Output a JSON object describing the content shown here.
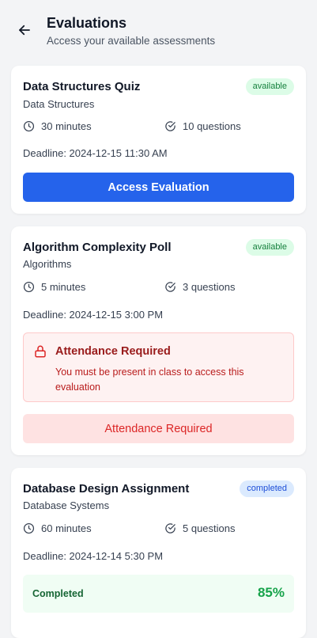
{
  "header": {
    "title": "Evaluations",
    "subtitle": "Access your available assessments"
  },
  "evaluations": [
    {
      "title": "Data Structures Quiz",
      "course": "Data Structures",
      "status": "available",
      "duration": "30 minutes",
      "questions": "10 questions",
      "deadline": "Deadline: 2024-12-15 11:30 AM",
      "action_label": "Access Evaluation"
    },
    {
      "title": "Algorithm Complexity Poll",
      "course": "Algorithms",
      "status": "available",
      "duration": "5 minutes",
      "questions": "3 questions",
      "deadline": "Deadline: 2024-12-15 3:00 PM",
      "alert": {
        "title": "Attendance Required",
        "text": "You must be present in class to access this evaluation"
      },
      "action_label": "Attendance Required"
    },
    {
      "title": "Database Design Assignment",
      "course": "Database Systems",
      "status": "completed",
      "duration": "60 minutes",
      "questions": "5 questions",
      "deadline": "Deadline: 2024-12-14 5:30 PM",
      "result": {
        "label": "Completed",
        "score": "85%"
      }
    }
  ],
  "colors": {
    "primary": "#2563eb",
    "danger": "#dc2626",
    "success": "#16a34a",
    "background": "#f3f4f6"
  },
  "icons": {
    "back": "arrow-left-icon",
    "duration": "clock-icon",
    "questions": "check-circle-icon",
    "locked": "lock-icon"
  }
}
